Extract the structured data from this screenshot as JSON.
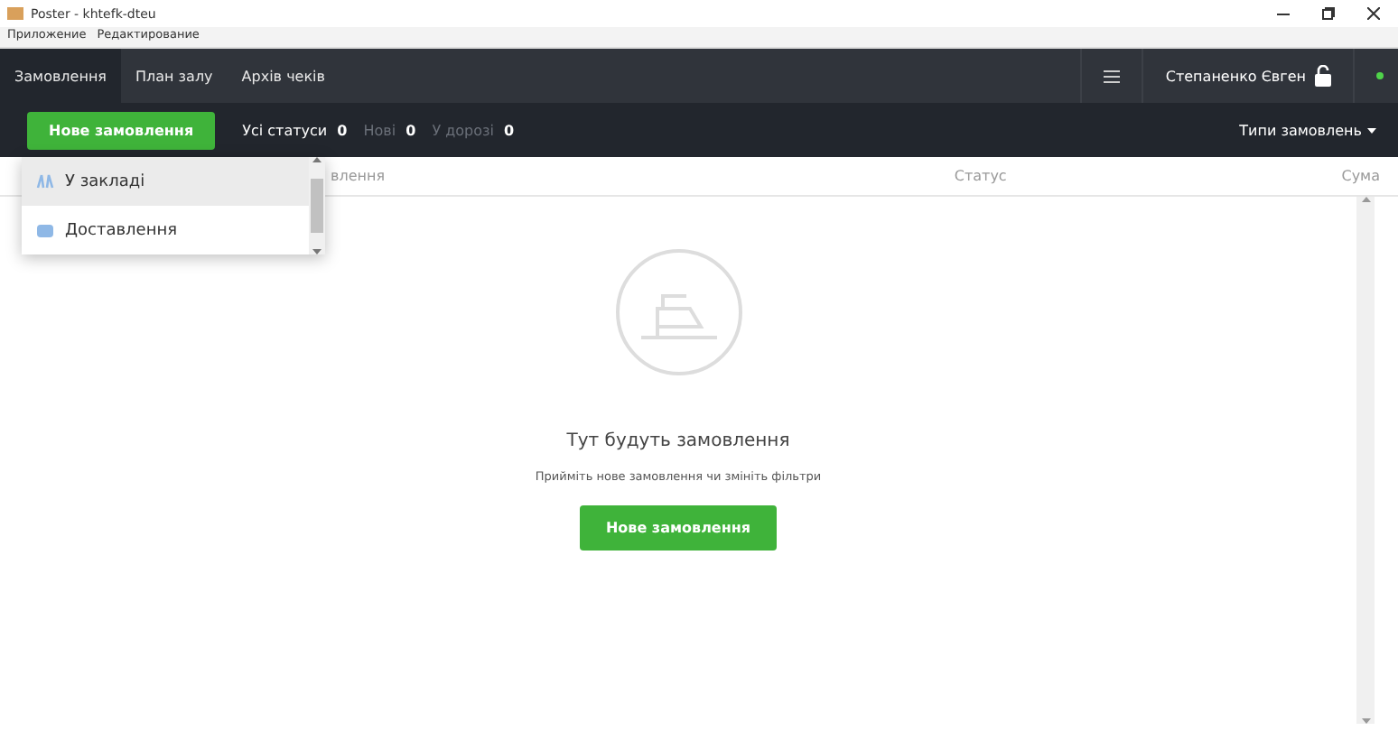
{
  "window": {
    "title": "Poster - khtefk-dteu"
  },
  "menu": [
    "Приложение",
    "Редактирование"
  ],
  "tabs": [
    {
      "label": "Замовлення",
      "selected": true
    },
    {
      "label": "План залу",
      "selected": false
    },
    {
      "label": "Архів чеків",
      "selected": false
    }
  ],
  "user": {
    "name": "Степаненко Євген"
  },
  "new_order_button": "Нове замовлення",
  "filters": [
    {
      "label": "Усі статуси",
      "count": "0",
      "selected": true
    },
    {
      "label": "Нові",
      "count": "0",
      "selected": false
    },
    {
      "label": "У дорозі",
      "count": "0",
      "selected": false
    }
  ],
  "order_types": "Типи замовлень",
  "dropdown": [
    {
      "kind": "dine-in",
      "label": "У закладі",
      "selected": true
    },
    {
      "kind": "delivery",
      "label": "Доставлення",
      "selected": false
    }
  ],
  "table": {
    "columns": [
      "влення",
      "Статус",
      "Сума"
    ]
  },
  "empty_state": {
    "title": "Тут будуть замовлення",
    "hint": "Прийміть нове замовлення чи змініть фільтри",
    "button": "Нове замовлення"
  }
}
